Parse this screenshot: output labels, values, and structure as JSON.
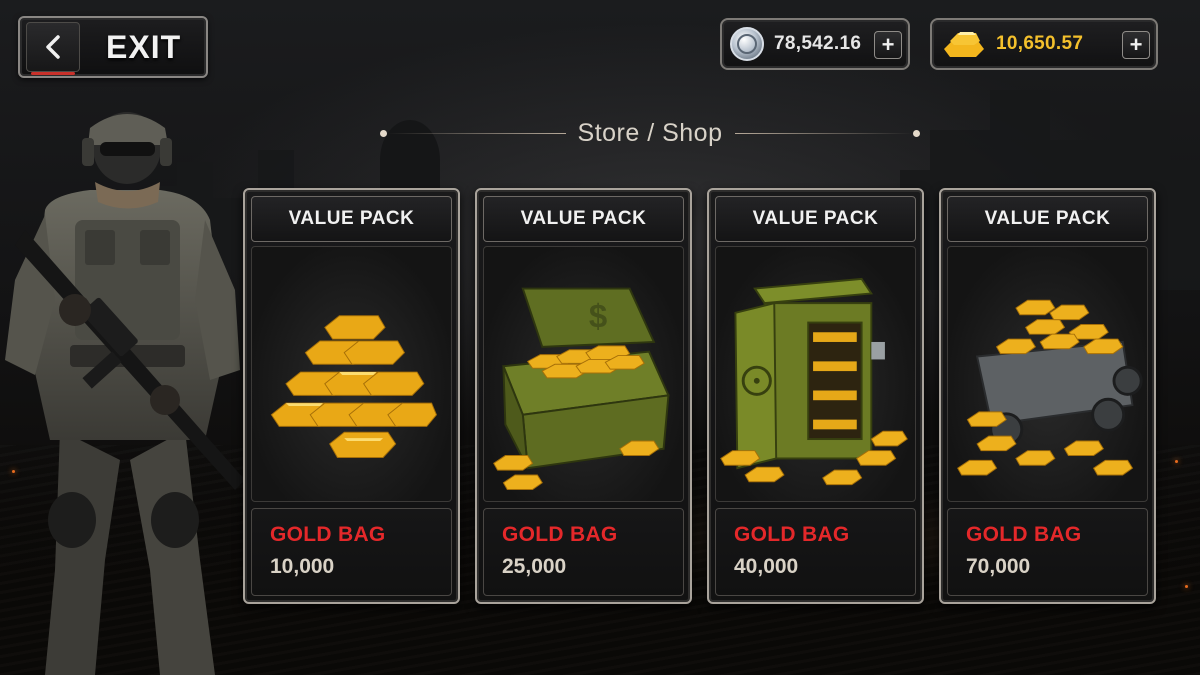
{
  "header": {
    "exit_label": "EXIT",
    "title": "Store / Shop"
  },
  "currencies": {
    "silver": {
      "icon": "silver-coin-icon",
      "value": "78,542.16"
    },
    "gold": {
      "icon": "gold-bar-icon",
      "value": "10,650.57"
    },
    "add_label": "+"
  },
  "packs": [
    {
      "header": "VALUE PACK",
      "name": "GOLD BAG",
      "amount": "10,000",
      "art": "gold-bar-stack"
    },
    {
      "header": "VALUE PACK",
      "name": "GOLD BAG",
      "amount": "25,000",
      "art": "gold-ammo-crate"
    },
    {
      "header": "VALUE PACK",
      "name": "GOLD BAG",
      "amount": "40,000",
      "art": "gold-safe"
    },
    {
      "header": "VALUE PACK",
      "name": "GOLD BAG",
      "amount": "70,000",
      "art": "gold-mine-cart"
    }
  ],
  "colors": {
    "accent_red": "#e4282a",
    "gold": "#f4c02c",
    "frame": "#a9a39b"
  }
}
